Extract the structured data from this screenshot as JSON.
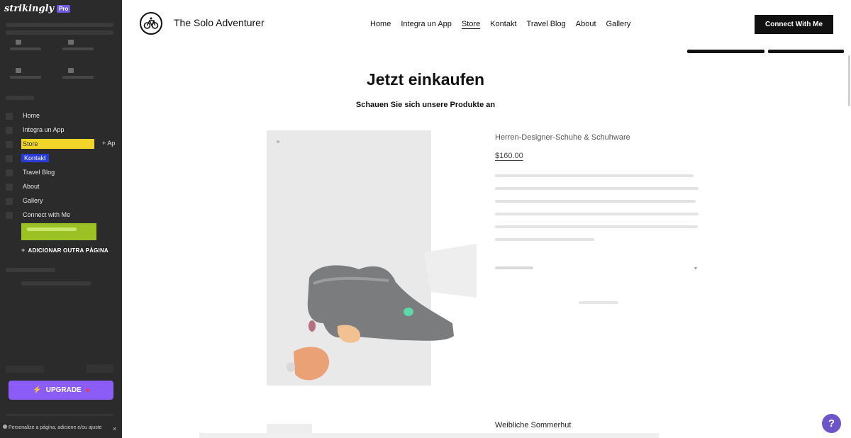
{
  "sidebar": {
    "brand": "strikingly",
    "badge": "Pro",
    "pages": [
      {
        "label": "Home"
      },
      {
        "label": "Integra un App"
      },
      {
        "label": "Store",
        "extra": "+ Ap"
      },
      {
        "label": "Kontakt"
      },
      {
        "label": "Travel Blog"
      },
      {
        "label": "About"
      },
      {
        "label": "Gallery"
      },
      {
        "label": "Connect with Me"
      }
    ],
    "add_page": "ADICIONAR OUTRA PÁGINA",
    "add_page_icon": "+",
    "upgrade_label": "UPGRADE",
    "upgrade_icon": "⚡",
    "footer_note": "Personalize a página, adicione e/ou ajuste",
    "footer_close": "×"
  },
  "header": {
    "site_title": "The Solo Adventurer",
    "nav": [
      "Home",
      "Integra un App",
      "Store",
      "Kontakt",
      "Travel Blog",
      "About",
      "Gallery"
    ],
    "active_nav": "Store",
    "cta": "Connect With Me"
  },
  "main": {
    "heading": "Jetzt einkaufen",
    "subheading": "Schauen Sie sich unsere Produkte an",
    "product": {
      "name": "Herren-Designer-Schuhe & Schuhware",
      "price": "$160.00"
    },
    "next_product_name": "Weibliche Sommerhut"
  },
  "help": {
    "label": "?"
  },
  "colors": {
    "sidebar_bg": "#2b2b2b",
    "store_highlight": "#f1d629",
    "kontakt_highlight": "#2a3ad6",
    "upgrade": "#8b5cf6",
    "cta_bg": "#111111"
  },
  "icons": {
    "logo": "bicycle-icon",
    "upgrade": "lightning-icon",
    "help": "question-icon"
  }
}
